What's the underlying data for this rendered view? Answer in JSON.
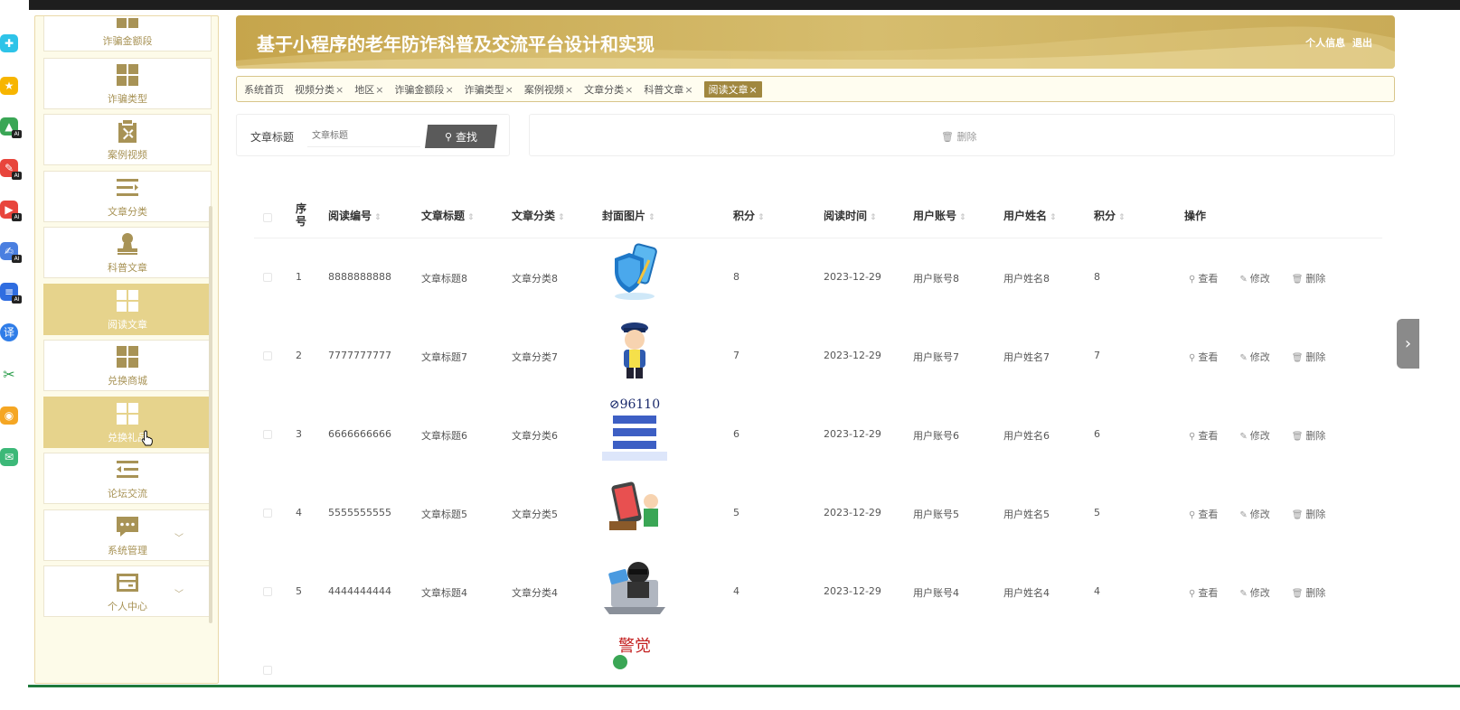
{
  "app": {
    "title": "基于小程序的老年防诈科普及交流平台设计和实现",
    "profile_link": "个人信息",
    "logout_link": "退出",
    "accent_color": "#c6a54c"
  },
  "sidebar": {
    "items": [
      {
        "label": "诈骗金额段",
        "icon": "grid-icon",
        "active": false
      },
      {
        "label": "诈骗类型",
        "icon": "grid-icon",
        "active": false
      },
      {
        "label": "案例视频",
        "icon": "clipboard-x-icon",
        "active": false
      },
      {
        "label": "文章分类",
        "icon": "list-icon",
        "active": false
      },
      {
        "label": "科普文章",
        "icon": "user-stamp-icon",
        "active": false
      },
      {
        "label": "阅读文章",
        "icon": "grid-icon",
        "active": true
      },
      {
        "label": "兑换商城",
        "icon": "grid-icon",
        "active": false
      },
      {
        "label": "兑换礼品",
        "icon": "grid-icon",
        "active": true
      },
      {
        "label": "论坛交流",
        "icon": "indent-list-icon",
        "active": false
      },
      {
        "label": "系统管理",
        "icon": "chat-bubble-icon",
        "active": false
      },
      {
        "label": "个人中心",
        "icon": "card-icon",
        "active": false
      }
    ]
  },
  "tabs": [
    {
      "label": "系统首页",
      "closable": false
    },
    {
      "label": "视频分类",
      "closable": true
    },
    {
      "label": "地区",
      "closable": true
    },
    {
      "label": "诈骗金额段",
      "closable": true
    },
    {
      "label": "诈骗类型",
      "closable": true
    },
    {
      "label": "案例视频",
      "closable": true
    },
    {
      "label": "文章分类",
      "closable": true
    },
    {
      "label": "科普文章",
      "closable": true
    },
    {
      "label": "阅读文章",
      "closable": true,
      "active": true
    }
  ],
  "search": {
    "label": "文章标题",
    "placeholder": "文章标题",
    "button_label": "查找"
  },
  "actions": {
    "delete_label": "删除"
  },
  "table": {
    "headers": {
      "seq": "序号",
      "read_id": "阅读编号",
      "title": "文章标题",
      "category": "文章分类",
      "cover": "封面图片",
      "points": "积分",
      "read_time": "阅读时间",
      "account": "用户账号",
      "name": "用户姓名",
      "points2": "积分",
      "ops": "操作"
    },
    "ops": {
      "view": "查看",
      "edit": "修改",
      "delete": "删除"
    },
    "rows": [
      {
        "seq": "1",
        "read_id": "8888888888",
        "title": "文章标题8",
        "category": "文章分类8",
        "cover": "shield-phone-image",
        "points": "8",
        "read_time": "2023-12-29",
        "account": "用户账号8",
        "name": "用户姓名8",
        "points2": "8"
      },
      {
        "seq": "2",
        "read_id": "7777777777",
        "title": "文章标题7",
        "category": "文章分类7",
        "cover": "police-officer-image",
        "points": "7",
        "read_time": "2023-12-29",
        "account": "用户账号7",
        "name": "用户姓名7",
        "points2": "7"
      },
      {
        "seq": "3",
        "read_id": "6666666666",
        "title": "文章标题6",
        "category": "文章分类6",
        "cover": "hotline-poster-image",
        "cover_text": "96110",
        "points": "6",
        "read_time": "2023-12-29",
        "account": "用户账号6",
        "name": "用户姓名6",
        "points2": "6"
      },
      {
        "seq": "4",
        "read_id": "5555555555",
        "title": "文章标题5",
        "category": "文章分类5",
        "cover": "phone-scam-image",
        "points": "5",
        "read_time": "2023-12-29",
        "account": "用户账号5",
        "name": "用户姓名5",
        "points2": "5"
      },
      {
        "seq": "5",
        "read_id": "4444444444",
        "title": "文章标题4",
        "category": "文章分类4",
        "cover": "hacker-laptop-image",
        "points": "4",
        "read_time": "2023-12-29",
        "account": "用户账号4",
        "name": "用户姓名4",
        "points2": "4"
      },
      {
        "seq": "",
        "read_id": "",
        "title": "",
        "category": "",
        "cover": "warning-poster-image",
        "cover_text": "警觉",
        "points": "",
        "read_time": "",
        "account": "",
        "name": "",
        "points2": ""
      }
    ]
  }
}
